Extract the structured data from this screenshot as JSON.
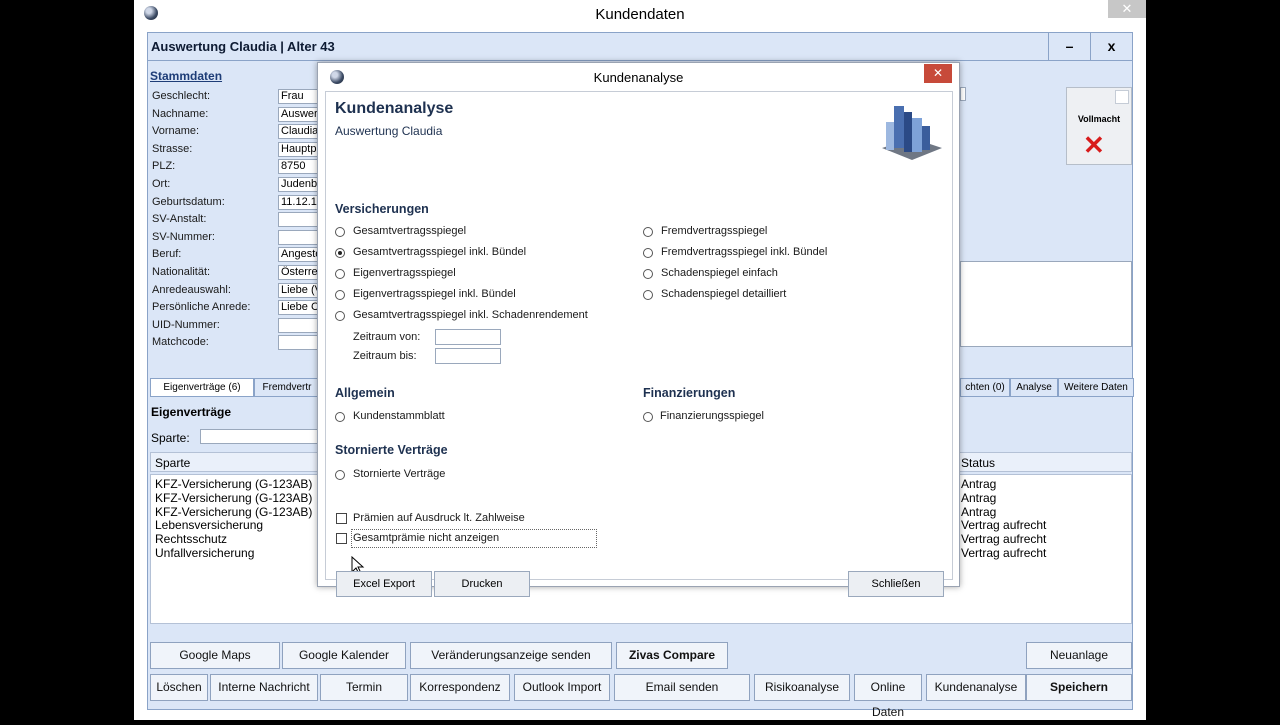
{
  "window": {
    "title": "Kundendaten",
    "close": "✕"
  },
  "app": {
    "header_title": "Auswertung Claudia   |  Alter 43",
    "minimize": "–",
    "close": "x",
    "stammdaten_title": "Stammdaten",
    "fields": [
      {
        "label": "Geschlecht:",
        "value": "Frau"
      },
      {
        "label": "Nachname:",
        "value": "Auswer"
      },
      {
        "label": "Vorname:",
        "value": "Claudia"
      },
      {
        "label": "Strasse:",
        "value": "Hauptp"
      },
      {
        "label": "PLZ:",
        "value": "8750"
      },
      {
        "label": "Ort:",
        "value": "Judenb"
      },
      {
        "label": "Geburtsdatum:",
        "value": "11.12.1"
      },
      {
        "label": "SV-Anstalt:",
        "value": ""
      },
      {
        "label": "SV-Nummer:",
        "value": ""
      },
      {
        "label": "Beruf:",
        "value": "Angeste"
      },
      {
        "label": "Nationalität:",
        "value": "Österre"
      },
      {
        "label": "Anredeauswahl:",
        "value": "Liebe (V"
      },
      {
        "label": "Persönliche Anrede:",
        "value": "Liebe C"
      },
      {
        "label": "UID-Nummer:",
        "value": ""
      },
      {
        "label": "Matchcode:",
        "value": ""
      }
    ],
    "vollmacht_label": "Vollmacht",
    "tabs": {
      "eigenvertraege": "Eigenverträge (6)",
      "fremdvertraege": "Fremdvertr",
      "nachrichten": "chten (0)",
      "analyse": "Analyse",
      "weitere": "Weitere Daten"
    },
    "section_title": "Eigenverträge",
    "sparte_label": "Sparte:",
    "grid": {
      "col_sparte": "Sparte",
      "col_status": "Status",
      "rows": [
        {
          "sparte": "KFZ-Versicherung (G-123AB)",
          "status": "Antrag"
        },
        {
          "sparte": "KFZ-Versicherung (G-123AB)",
          "status": "Antrag"
        },
        {
          "sparte": "KFZ-Versicherung (G-123AB)",
          "status": "Antrag"
        },
        {
          "sparte": "Lebensversicherung",
          "status": "Vertrag aufrecht"
        },
        {
          "sparte": "Rechtsschutz",
          "status": "Vertrag aufrecht"
        },
        {
          "sparte": "Unfallversicherung",
          "status": "Vertrag aufrecht"
        }
      ]
    },
    "buttons_row1": [
      "Google Maps",
      "Google Kalender",
      "Veränderungsanzeige senden",
      "Zivas Compare",
      "Neuanlage"
    ],
    "buttons_row2": [
      "Löschen",
      "Interne Nachricht",
      "Termin",
      "Korrespondenz",
      "Outlook Import",
      "Email senden",
      "Risikoanalyse",
      "Online Daten",
      "Kundenanalyse",
      "Speichern"
    ]
  },
  "dialog": {
    "title": "Kundenanalyse",
    "close": "✕",
    "heading": "Kundenanalyse",
    "subheading": "Auswertung Claudia",
    "versicherungen_title": "Versicherungen",
    "versicherungen_left": [
      {
        "label": "Gesamtvertragsspiegel",
        "selected": false
      },
      {
        "label": "Gesamtvertragsspiegel inkl. Bündel",
        "selected": true
      },
      {
        "label": "Eigenvertragsspiegel",
        "selected": false
      },
      {
        "label": "Eigenvertragsspiegel inkl. Bündel",
        "selected": false
      },
      {
        "label": "Gesamtvertragsspiegel inkl. Schadenrendement",
        "selected": false
      }
    ],
    "versicherungen_right": [
      {
        "label": "Fremdvertragsspiegel",
        "selected": false
      },
      {
        "label": "Fremdvertragsspiegel inkl. Bündel",
        "selected": false
      },
      {
        "label": "Schadenspiegel einfach",
        "selected": false
      },
      {
        "label": "Schadenspiegel detailliert",
        "selected": false
      }
    ],
    "zeitraum_von_label": "Zeitraum von:",
    "zeitraum_bis_label": "Zeitraum bis:",
    "zeitraum_von_value": "",
    "zeitraum_bis_value": "",
    "allgemein_title": "Allgemein",
    "allgemein_item": "Kundenstammblatt",
    "finanzierungen_title": "Finanzierungen",
    "finanzierungen_item": "Finanzierungsspiegel",
    "storniert_title": "Stornierte Verträge",
    "storniert_item": "Stornierte Verträge",
    "check_praemien": "Prämien auf Ausdruck lt. Zahlweise",
    "check_gesamt": "Gesamtprämie nicht anzeigen",
    "btn_excel": "Excel Export",
    "btn_drucken": "Drucken",
    "btn_schliessen": "Schließen"
  }
}
